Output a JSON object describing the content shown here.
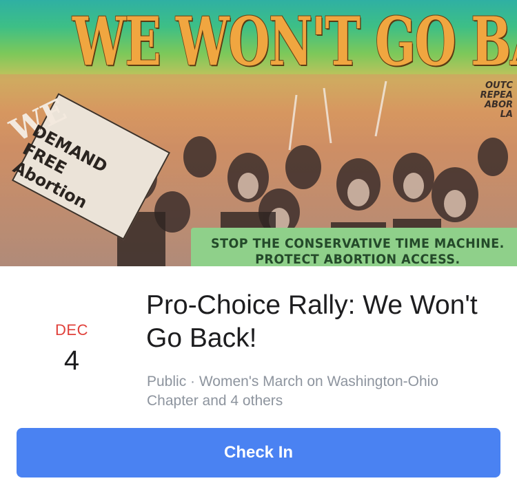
{
  "cover": {
    "headline": "WE WON'T GO BACK",
    "banner_line1": "STOP THE CONSERVATIVE TIME MACHINE.",
    "banner_line2": "PROTECT ABORTION ACCESS.",
    "sign_we": "WE",
    "sign_free": "DEMAND\nFREE\nAbortion",
    "side_sign": "OUTC\nREPEA\nABOR\nLA",
    "colors": {
      "headline": "#f0a640",
      "banner": "#8fd08a"
    }
  },
  "event": {
    "month": "DEC",
    "day": "4",
    "title": "Pro-Choice Rally: We Won't Go Back!",
    "subtitle": "Public · Women's March on Washington-Ohio Chapter and 4 others"
  },
  "actions": {
    "check_in_label": "Check In"
  },
  "colors": {
    "accent": "#4a82f2",
    "month": "#e0403a",
    "secondary_text": "#8d949e"
  }
}
